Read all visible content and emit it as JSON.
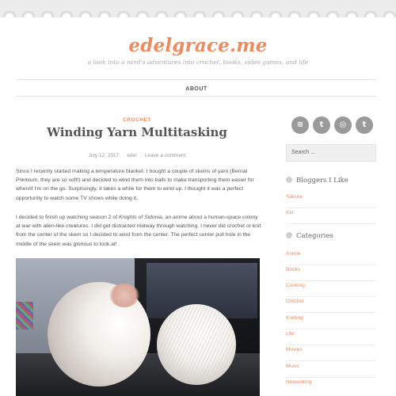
{
  "site": {
    "title": "edelgrace.me",
    "tagline": "a look into a nerd's adventures into crochet, books, video games, and life"
  },
  "nav": {
    "items": [
      {
        "label": "ABOUT"
      }
    ]
  },
  "post": {
    "category": "CROCHET",
    "title": "Winding Yarn Multitasking",
    "date": "July 12, 2017",
    "author": "edel",
    "comment_link": "Leave a comment",
    "paragraphs": [
      "Since I recently started making a temperature blanket. I bought a couple of skeins of yarn (Bernat Premium, they are so soft!) and decided to wind them into balls to make transporting them easier for when/if I'm on the go. Surprisingly, it takes a while for them to wind up. I thought it was a perfect opportunity to watch some TV shows while doing it."
    ],
    "p2_before": "I decided to finish up watching season 2 of ",
    "p2_italic": "Knights of Sidonia",
    "p2_after": ", an anime about a human-space colony at war with alien-like creatures. I did get distracted midway through watching. I never did crochet or knit from the center of the skein so I decided to wind from the center. The perfect center pull hole in the middle of the skein was glorious to look at!"
  },
  "sidebar": {
    "social": [
      {
        "icon": "buffer-icon",
        "glyph": "≋"
      },
      {
        "icon": "twitter-icon",
        "glyph": "t"
      },
      {
        "icon": "instagram-icon",
        "glyph": "◎"
      },
      {
        "icon": "tumblr-icon",
        "glyph": "t"
      }
    ],
    "search_placeholder": "Search ...",
    "bloggers": {
      "title": "Bloggers I Like",
      "links": [
        "Sakura",
        "Kin"
      ]
    },
    "categories": {
      "title": "Categories",
      "links": [
        "Anime",
        "Books",
        "Cooking",
        "Crochet",
        "Knitting",
        "Life",
        "Movies",
        "Music",
        "Networking"
      ]
    }
  },
  "colors": {
    "accent": "#f08a5d",
    "text": "#555555",
    "muted": "#999999"
  }
}
